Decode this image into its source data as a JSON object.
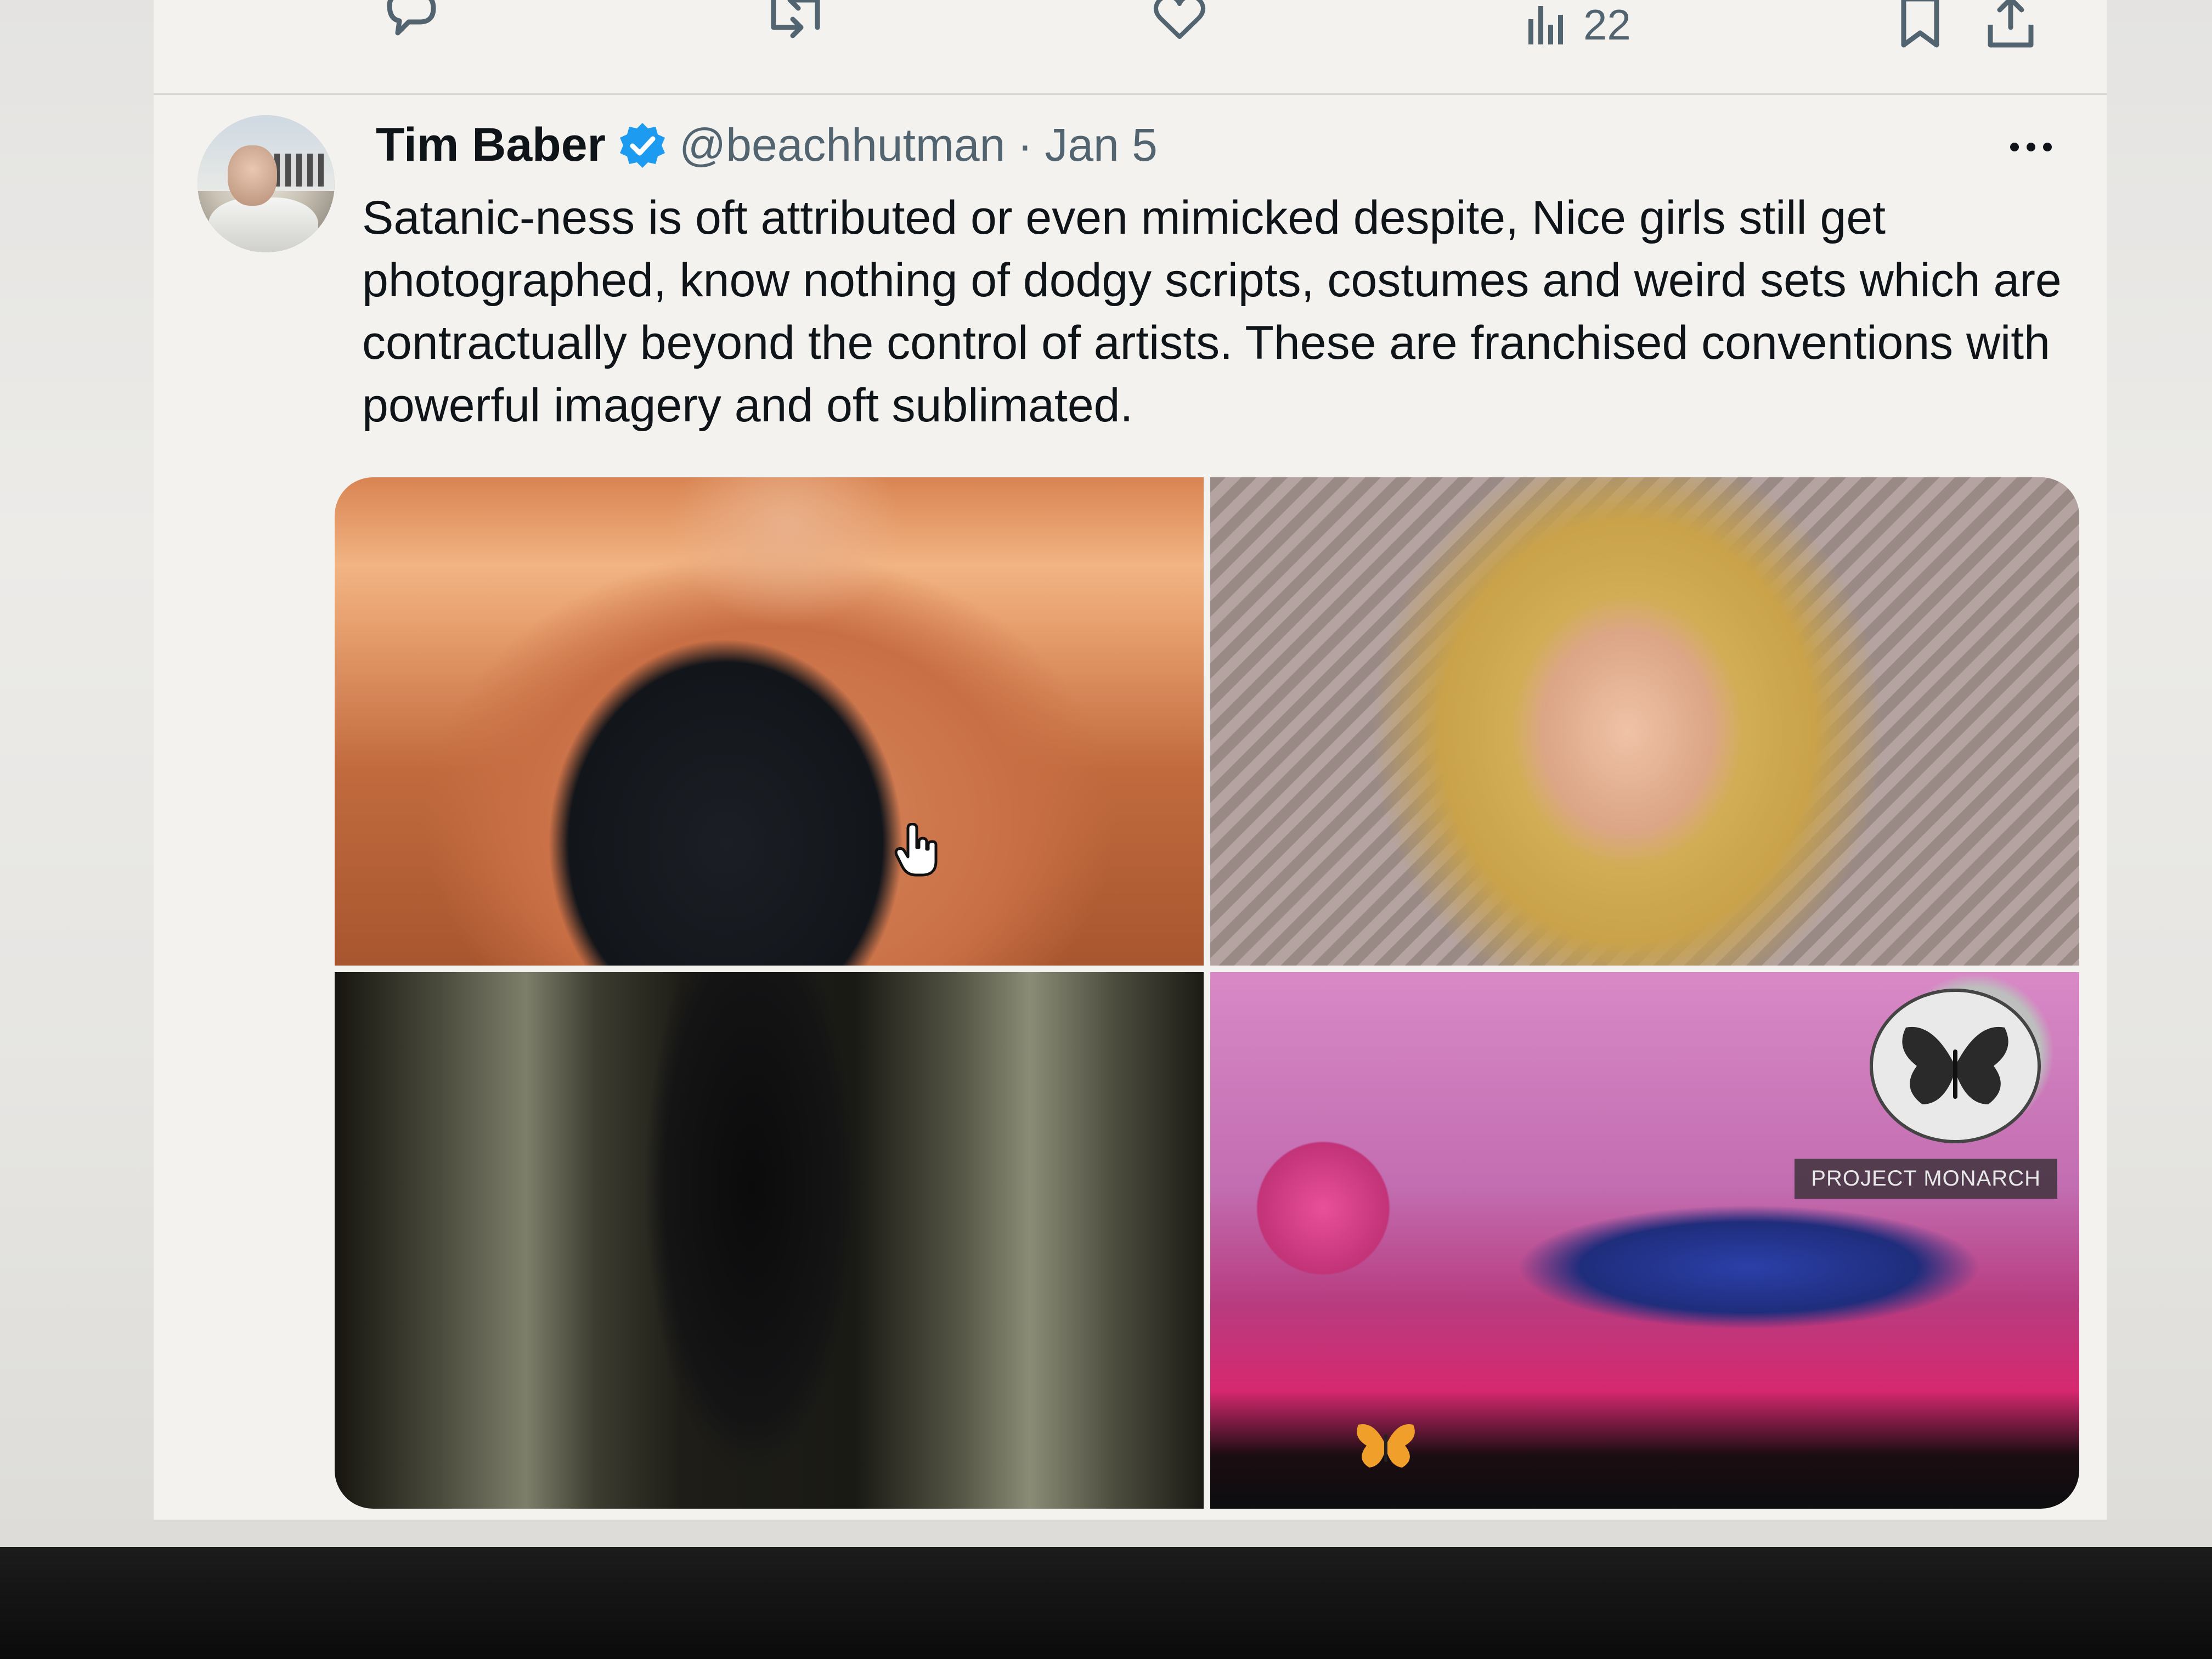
{
  "previous_tweet": {
    "actions": {
      "reply_icon": "reply-icon",
      "retweet_icon": "retweet-icon",
      "like_icon": "heart-icon",
      "views_icon": "views-icon",
      "views_count": "22",
      "bookmark_icon": "bookmark-icon",
      "share_icon": "share-icon"
    }
  },
  "tweet": {
    "author_name": "Tim Baber",
    "verified": true,
    "handle": "@beachhutman",
    "separator": "·",
    "date": "Jan 5",
    "text": "Satanic-ness is oft attributed or even mimicked despite, Nice girls still get photographed, know nothing of dodgy scripts, costumes and weird sets which are contractually beyond the control of artists. These are franchised conventions with powerful imagery and oft sublimated.",
    "media": {
      "image_4_label": "PROJECT MONARCH"
    }
  },
  "colors": {
    "text_primary": "#0f1419",
    "text_secondary": "#536471",
    "verified_blue": "#1d9bf0",
    "background": "#f3f2ef"
  }
}
